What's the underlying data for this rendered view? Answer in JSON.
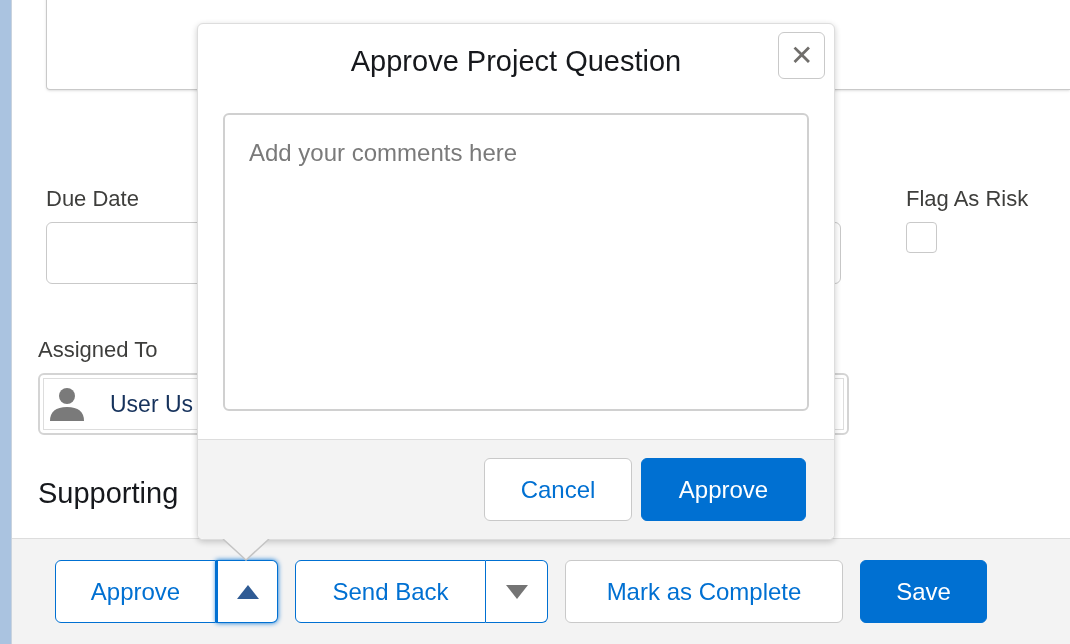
{
  "form": {
    "due_date": {
      "label": "Due Date"
    },
    "flag_as_risk": {
      "label": "Flag As Risk",
      "checked": false
    },
    "assigned_to": {
      "label": "Assigned To",
      "value": "User Us"
    },
    "section_heading": "Supporting"
  },
  "popover": {
    "title": "Approve Project Question",
    "close": "✕",
    "comment_placeholder": "Add your comments here",
    "buttons": [
      {
        "label": "Cancel",
        "kind": "neutral"
      },
      {
        "label": "Approve",
        "kind": "brand"
      }
    ]
  },
  "footer_buttons": [
    {
      "label": "Approve",
      "kind": "split",
      "expanded": true
    },
    {
      "label": "Send Back",
      "kind": "split",
      "expanded": false
    },
    {
      "label": "Mark as Complete",
      "kind": "neutral"
    },
    {
      "label": "Save",
      "kind": "brand"
    }
  ]
}
